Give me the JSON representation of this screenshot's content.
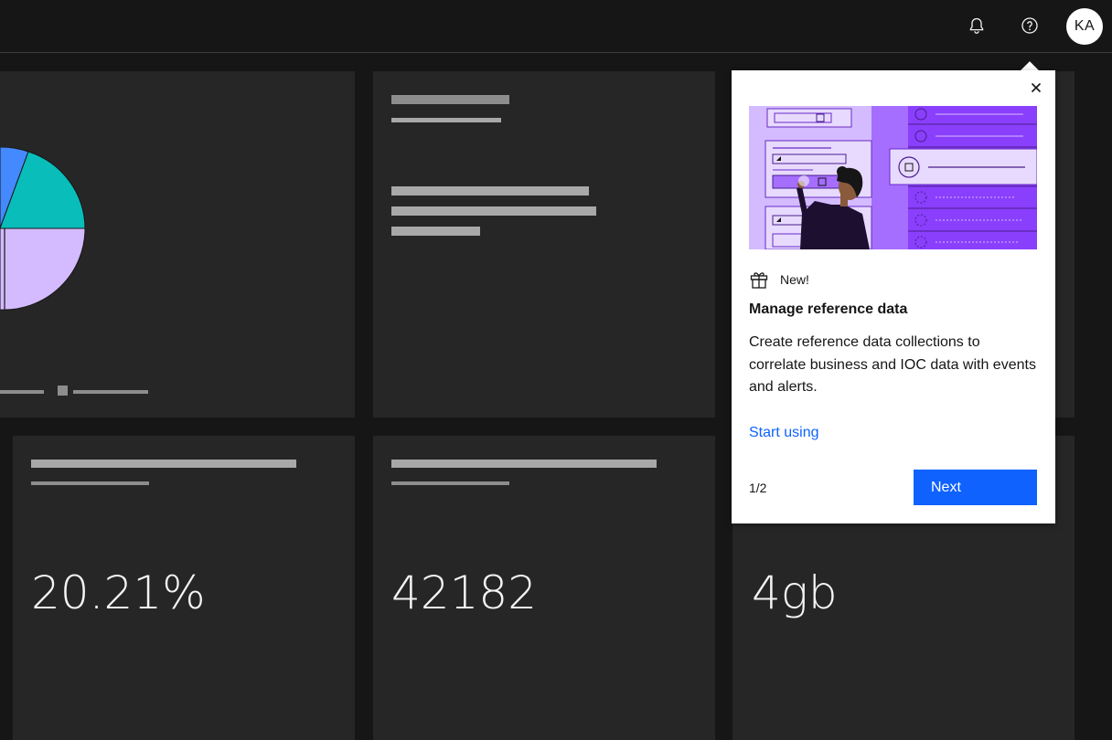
{
  "header": {
    "notification_icon": "bell-icon",
    "help_icon": "help-icon",
    "avatar_initials": "KA"
  },
  "tiles": {
    "percent_value": "20.21%",
    "count_value": "42182",
    "storage_value": "4gb"
  },
  "pie_chart": {
    "slice_colors": [
      "#4589ff",
      "#08bdba",
      "#d4bbff"
    ]
  },
  "popover": {
    "close_icon": "close-icon",
    "badge_icon": "gift-icon",
    "badge_label": "New!",
    "title": "Manage reference data",
    "body": "Create reference data collections to correlate business and IOC data with events and alerts.",
    "link_label": "Start using",
    "step": "1/2",
    "next_label": "Next"
  },
  "colors": {
    "accent": "#0f62fe",
    "illustration_purple": "#a56eff"
  }
}
